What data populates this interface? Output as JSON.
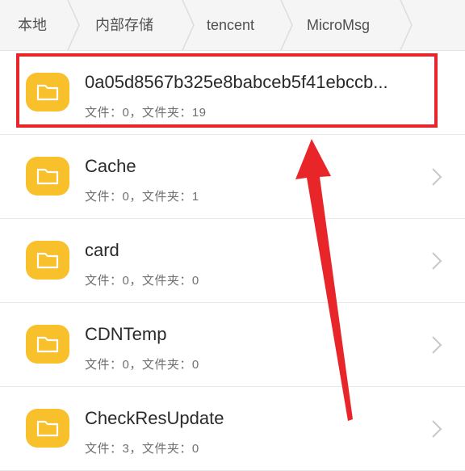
{
  "breadcrumb": {
    "items": [
      {
        "label": "本地"
      },
      {
        "label": "内部存储"
      },
      {
        "label": "tencent"
      },
      {
        "label": "MicroMsg"
      }
    ]
  },
  "files": [
    {
      "name": "0a05d8567b325e8babceb5f41ebccb...",
      "meta": "文件：0，文件夹：19",
      "icon": "folder-icon"
    },
    {
      "name": "Cache",
      "meta": "文件：0，文件夹：1",
      "icon": "folder-icon"
    },
    {
      "name": "card",
      "meta": "文件：0，文件夹：0",
      "icon": "folder-icon"
    },
    {
      "name": "CDNTemp",
      "meta": "文件：0，文件夹：0",
      "icon": "folder-icon"
    },
    {
      "name": "CheckResUpdate",
      "meta": "文件：3，文件夹：0",
      "icon": "folder-icon"
    }
  ],
  "colors": {
    "folder": "#f8c02b",
    "annotation": "#e8262a",
    "breadcrumb_bg": "#f5f5f5"
  }
}
